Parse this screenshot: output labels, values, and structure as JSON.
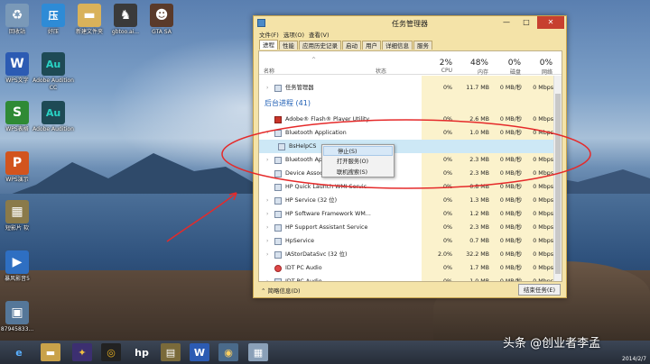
{
  "desktop_icons": [
    {
      "label": "回收站",
      "glyph": "♻",
      "color": "#7a99b8"
    },
    {
      "label": "好压",
      "glyph": "压",
      "color": "#2e8bd6"
    },
    {
      "label": "新建文件夹",
      "glyph": "▬",
      "color": "#d9b25a"
    },
    {
      "label": "gbtoo.ai...",
      "glyph": "♞",
      "color": "#3a3a3a"
    },
    {
      "label": "GTA SA",
      "glyph": "☻",
      "color": "#5a3a2a"
    },
    {
      "label": "WPS文字",
      "glyph": "W",
      "color": "#2c5bb3"
    },
    {
      "label": "Adobe Audition CC",
      "glyph": "Au",
      "color": "#1e4a55"
    },
    {
      "label": "WPS表格",
      "glyph": "S",
      "color": "#2f8a35"
    },
    {
      "label": "Adobe Audition",
      "glyph": "Au",
      "color": "#1e4a55"
    },
    {
      "label": "WPS演示",
      "glyph": "P",
      "color": "#d2541e"
    },
    {
      "label": "短影片 软",
      "glyph": "▦",
      "color": "#8a7a4a"
    },
    {
      "label": "暴风影音5",
      "glyph": "▶",
      "color": "#2e6fc2"
    },
    {
      "label": "87945833...",
      "glyph": "▣",
      "color": "#557799"
    }
  ],
  "window": {
    "title": "任务管理器",
    "min": "—",
    "max": "□",
    "close": "✕",
    "menu": [
      "文件(F)",
      "选项(O)",
      "查看(V)"
    ],
    "tabs": [
      "进程",
      "性能",
      "应用历史记录",
      "启动",
      "用户",
      "详细信息",
      "服务"
    ],
    "columns": {
      "name": "名称",
      "status": "状态",
      "cpu_pct": "2%",
      "cpu": "CPU",
      "mem_pct": "48%",
      "mem": "内存",
      "disk_pct": "0%",
      "disk": "磁盘",
      "net_pct": "0%",
      "net": "网络"
    },
    "rows": [
      {
        "name": "任务管理器",
        "cpu": "0%",
        "mem": "11.7 MB",
        "disk": "0 MB/秒",
        "net": "0 Mbps",
        "exp": true
      },
      {
        "name": "Adobe® Flash® Player Utility",
        "cpu": "0%",
        "mem": "2.6 MB",
        "disk": "0 MB/秒",
        "net": "0 Mbps",
        "exp": false
      },
      {
        "name": "Bluetooth Application",
        "cpu": "0%",
        "mem": "1.0 MB",
        "disk": "0 MB/秒",
        "net": "0 Mbps",
        "exp": true
      },
      {
        "name": "BsHelpCS",
        "cpu": "",
        "mem": "",
        "disk": "",
        "net": "",
        "exp": false
      },
      {
        "name": "Bluetooth App",
        "cpu": "0%",
        "mem": "2.3 MB",
        "disk": "0 MB/秒",
        "net": "0 Mbps",
        "exp": true
      },
      {
        "name": "Device Associ",
        "cpu": "0%",
        "mem": "2.3 MB",
        "disk": "0 MB/秒",
        "net": "0 Mbps",
        "exp": false
      },
      {
        "name": "HP Quick Launch WMI Servic...",
        "cpu": "0%",
        "mem": "0.8 MB",
        "disk": "0 MB/秒",
        "net": "0 Mbps",
        "exp": false
      },
      {
        "name": "HP Service (32 位)",
        "cpu": "0%",
        "mem": "1.3 MB",
        "disk": "0 MB/秒",
        "net": "0 Mbps",
        "exp": true
      },
      {
        "name": "HP Software Framework WM...",
        "cpu": "0%",
        "mem": "1.2 MB",
        "disk": "0 MB/秒",
        "net": "0 Mbps",
        "exp": true
      },
      {
        "name": "HP Support Assistant Service",
        "cpu": "0%",
        "mem": "2.3 MB",
        "disk": "0 MB/秒",
        "net": "0 Mbps",
        "exp": true
      },
      {
        "name": "HpService",
        "cpu": "0%",
        "mem": "0.7 MB",
        "disk": "0 MB/秒",
        "net": "0 Mbps",
        "exp": true
      },
      {
        "name": "IAStorDataSvc (32 位)",
        "cpu": "2.0%",
        "mem": "32.2 MB",
        "disk": "0 MB/秒",
        "net": "0 Mbps",
        "exp": true
      },
      {
        "name": "IDT PC Audio",
        "cpu": "0%",
        "mem": "1.7 MB",
        "disk": "0 MB/秒",
        "net": "0 Mbps",
        "exp": false
      },
      {
        "name": "IDT PC Audio",
        "cpu": "0%",
        "mem": "1.0 MB",
        "disk": "0 MB/秒",
        "net": "0 Mbps",
        "exp": true
      }
    ],
    "group_label": "后台进程 (41)",
    "footer_less": "简略信息(D)",
    "footer_end": "结束任务(E)"
  },
  "context_menu": [
    "停止(S)",
    "打开服务(O)",
    "联机搜索(S)"
  ],
  "taskbar": {
    "date": "2014/2/7"
  },
  "watermark": "头条 @创业者李孟"
}
